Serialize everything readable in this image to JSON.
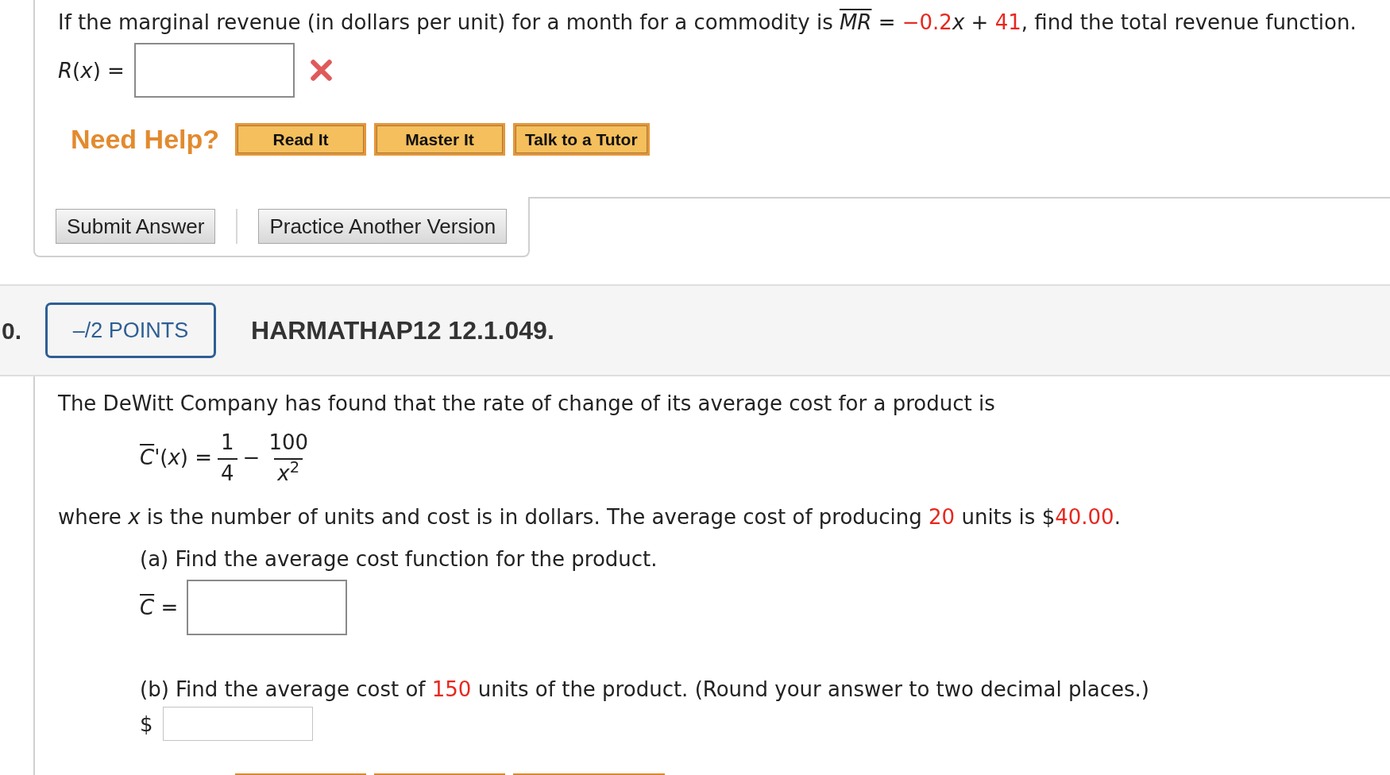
{
  "previous_question": {
    "prompt": [
      {
        "kind": "text",
        "text": "If the marginal revenue (in dollars per unit) for a month for a commodity is "
      },
      {
        "kind": "bar",
        "text": "MR"
      },
      {
        "kind": "text",
        "text": " = "
      },
      {
        "kind": "value",
        "text": "−0.2"
      },
      {
        "kind": "text",
        "text": "*x* + "
      },
      {
        "kind": "value",
        "text": "41"
      },
      {
        "kind": "text",
        "text": ", find the total revenue function."
      }
    ],
    "answer": {
      "label": "*R*(*x*) =",
      "incorrect": true
    },
    "help": {
      "label": "Need Help?",
      "buttons": [
        "Read It",
        "Master It",
        "Talk to a Tutor"
      ]
    },
    "actions": [
      "Submit Answer",
      "Practice Another Version"
    ]
  },
  "question": {
    "number": "0.",
    "points": "–/2 POINTS",
    "code": "HARMATHAP12 12.1.049.",
    "intro": [
      {
        "kind": "text",
        "text": "The DeWitt Company has found that the rate of change of its average cost for a product is"
      }
    ],
    "formula": {
      "lhs": [
        {
          "kind": "bar",
          "text": "C"
        },
        {
          "kind": "text",
          "text": "'(*x*) ="
        }
      ],
      "terms": [
        {
          "numerator": "1",
          "denominator": "4"
        },
        {
          "numerator": "100",
          "denominator": "*x*$^{2}$"
        }
      ],
      "operator": "−"
    },
    "statement": [
      {
        "kind": "text",
        "text": "where *x* is the number of units and cost is in dollars. The average cost of producing "
      },
      {
        "kind": "value",
        "text": "20"
      },
      {
        "kind": "text",
        "text": " units is $"
      },
      {
        "kind": "value",
        "text": "40.00"
      },
      {
        "kind": "text",
        "text": "."
      }
    ],
    "parts": [
      {
        "prompt": [
          {
            "kind": "text",
            "text": "(a) Find the average cost function for the product."
          }
        ],
        "answer": {
          "kind": "expression",
          "label": [
            {
              "kind": "bar",
              "text": "C"
            },
            {
              "kind": "text",
              "text": " ="
            }
          ]
        }
      },
      {
        "prompt": [
          {
            "kind": "text",
            "text": "(b) Find the average cost of "
          },
          {
            "kind": "value",
            "text": "150"
          },
          {
            "kind": "text",
            "text": " units of the product. (Round your answer to two decimal places.)"
          }
        ],
        "answer": {
          "kind": "number",
          "label": [
            {
              "kind": "text",
              "text": "$"
            }
          ]
        }
      }
    ]
  }
}
